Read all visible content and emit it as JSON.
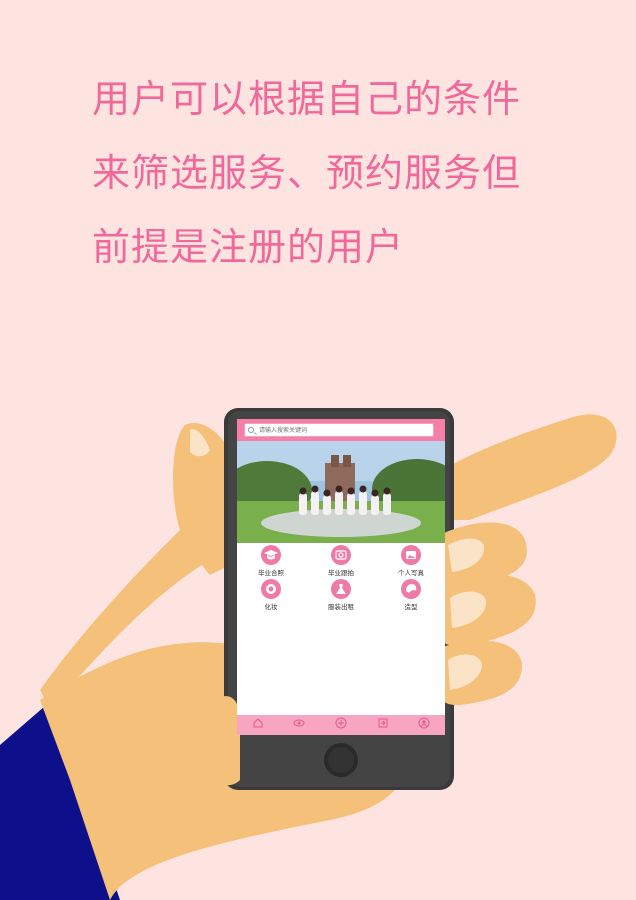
{
  "headline": {
    "line1": "用户可以根据自己的条件",
    "line2": "来筛选服务、预约服务但",
    "line3": "前提是注册的用户"
  },
  "app": {
    "search": {
      "placeholder": "请输入搜索关键词"
    },
    "categories": [
      {
        "label": "毕业合照",
        "icon": "graduation-cap-icon"
      },
      {
        "label": "毕业跟拍",
        "icon": "camera-icon"
      },
      {
        "label": "个人写真",
        "icon": "portrait-icon"
      },
      {
        "label": "化妆",
        "icon": "makeup-icon"
      },
      {
        "label": "服装出租",
        "icon": "dress-icon"
      },
      {
        "label": "造型",
        "icon": "hairstyle-icon"
      }
    ],
    "tabbar": [
      {
        "icon": "home-icon"
      },
      {
        "icon": "eye-icon"
      },
      {
        "icon": "plus-icon"
      },
      {
        "icon": "login-icon"
      },
      {
        "icon": "user-icon"
      }
    ]
  },
  "colors": {
    "background": "#fde4e1",
    "headline": "#f0699a",
    "accent": "#f67fa8",
    "hand": "#f5c07a",
    "sleeve": "#0e0f8a",
    "phone": "#3a3a3a"
  }
}
